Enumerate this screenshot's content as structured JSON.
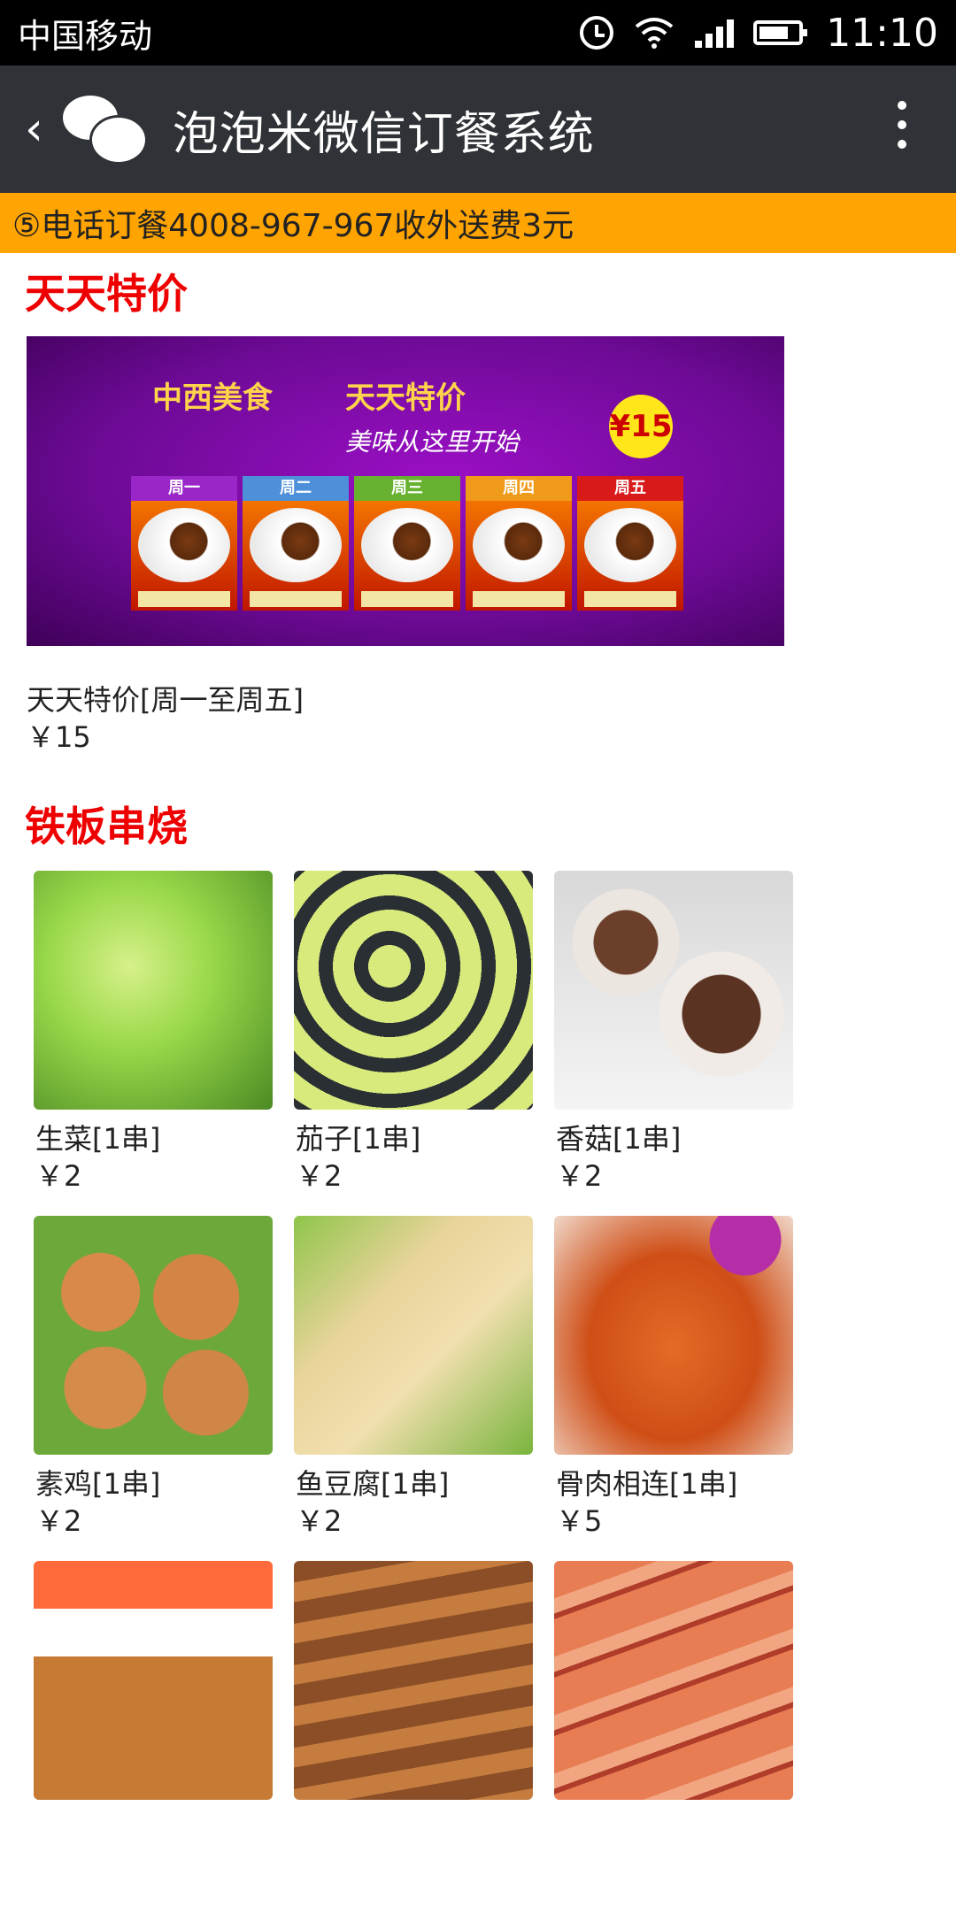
{
  "status_bar": {
    "carrier": "中国移动",
    "time": "11:10"
  },
  "app_bar": {
    "back_label": "‹",
    "title": "泡泡米微信订餐系统"
  },
  "notice": {
    "text": "⑤电话订餐4008-967-967收外送费3元"
  },
  "sections": [
    {
      "title": "天天特价",
      "banner": {
        "heading_left": "中西美食",
        "heading_right": "天天特价",
        "subtitle": "美味从这里开始",
        "badge": "¥15",
        "days": [
          "周一",
          "周二",
          "周三",
          "周四",
          "周五"
        ],
        "day_colors": [
          "#9b26c8",
          "#4d90d9",
          "#67b130",
          "#f09a1a",
          "#d91a1a"
        ]
      },
      "items": [
        {
          "name": "天天特价[周一至周五]",
          "price": "￥15"
        }
      ]
    },
    {
      "title": "铁板串烧",
      "items": [
        {
          "name": "生菜[1串]",
          "price": "￥2"
        },
        {
          "name": "茄子[1串]",
          "price": "￥2"
        },
        {
          "name": "香菇[1串]",
          "price": "￥2"
        },
        {
          "name": "素鸡[1串]",
          "price": "￥2"
        },
        {
          "name": "鱼豆腐[1串]",
          "price": "￥2"
        },
        {
          "name": "骨肉相连[1串]",
          "price": "￥5"
        }
      ]
    }
  ],
  "colors": {
    "section_title": "#ee0000",
    "notice_bg": "#ffa400",
    "app_bar_bg": "#2f3237"
  }
}
